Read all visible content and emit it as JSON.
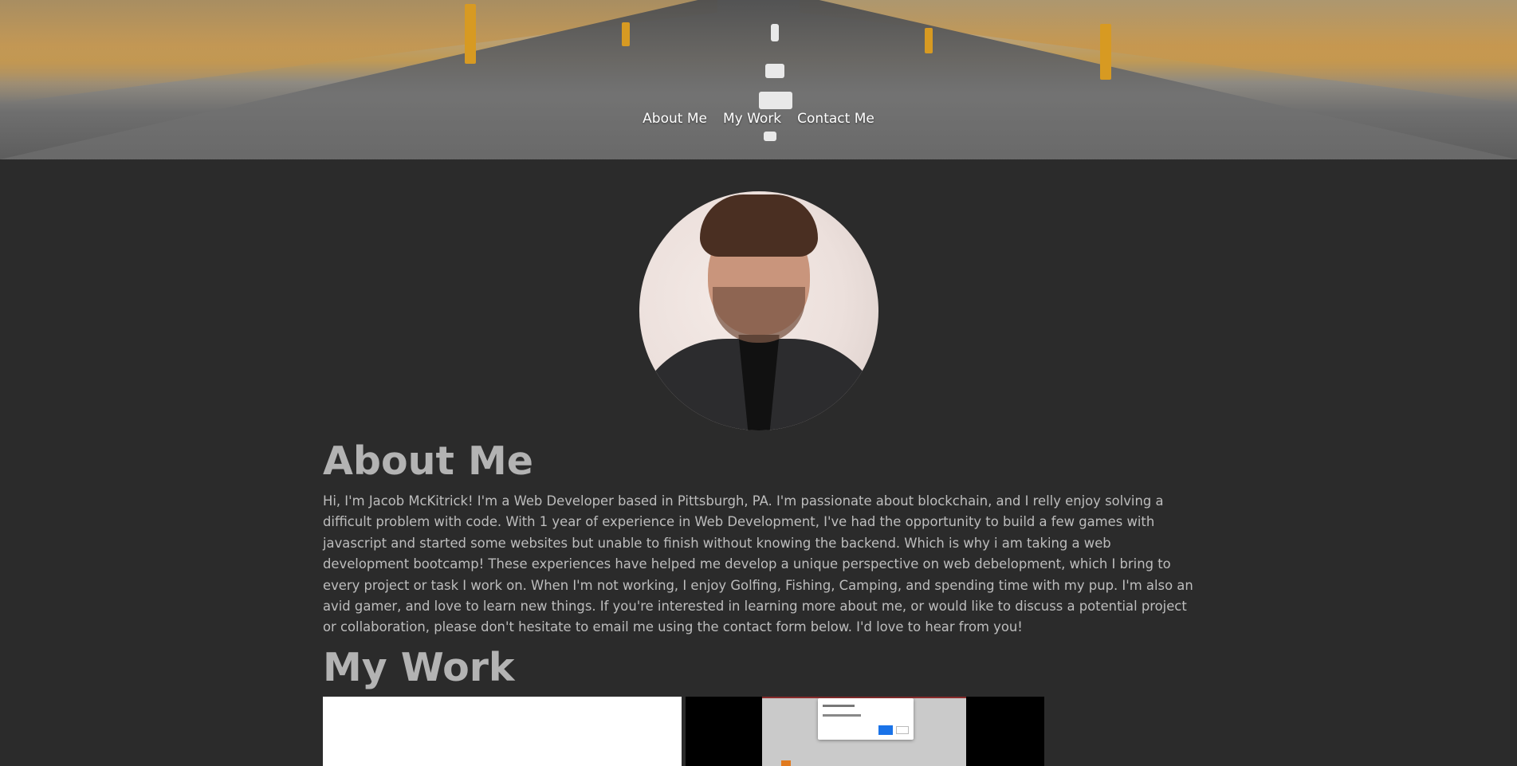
{
  "nav": {
    "items": [
      {
        "label": "About Me"
      },
      {
        "label": "My Work"
      },
      {
        "label": "Contact Me"
      }
    ]
  },
  "about": {
    "title": "About Me",
    "text": "Hi, I'm Jacob McKitrick! I'm a Web Developer based in Pittsburgh, PA. I'm passionate about blockchain, and I relly enjoy solving a difficult problem with code. With 1 year of experience in Web Development, I've had the opportunity to build a few games with javascript and started some websites but unable to finish without knowing the backend. Which is why i am taking a web development bootcamp! These experiences have helped me develop a unique perspective on web debelopment, which I bring to every project or task I work on. When I'm not working, I enjoy Golfing, Fishing, Camping, and spending time with my pup. I'm also an avid gamer, and love to learn new things. If you're interested in learning more about me, or would like to discuss a potential project or collaboration, please don't hesitate to email me using the contact form below. I'd love to hear from you!"
  },
  "work": {
    "title": "My Work"
  },
  "colors": {
    "background": "#2b2b2b",
    "heading": "#b3b3b3",
    "body_text": "#bdbdbd",
    "nav_text": "#ffffff"
  }
}
